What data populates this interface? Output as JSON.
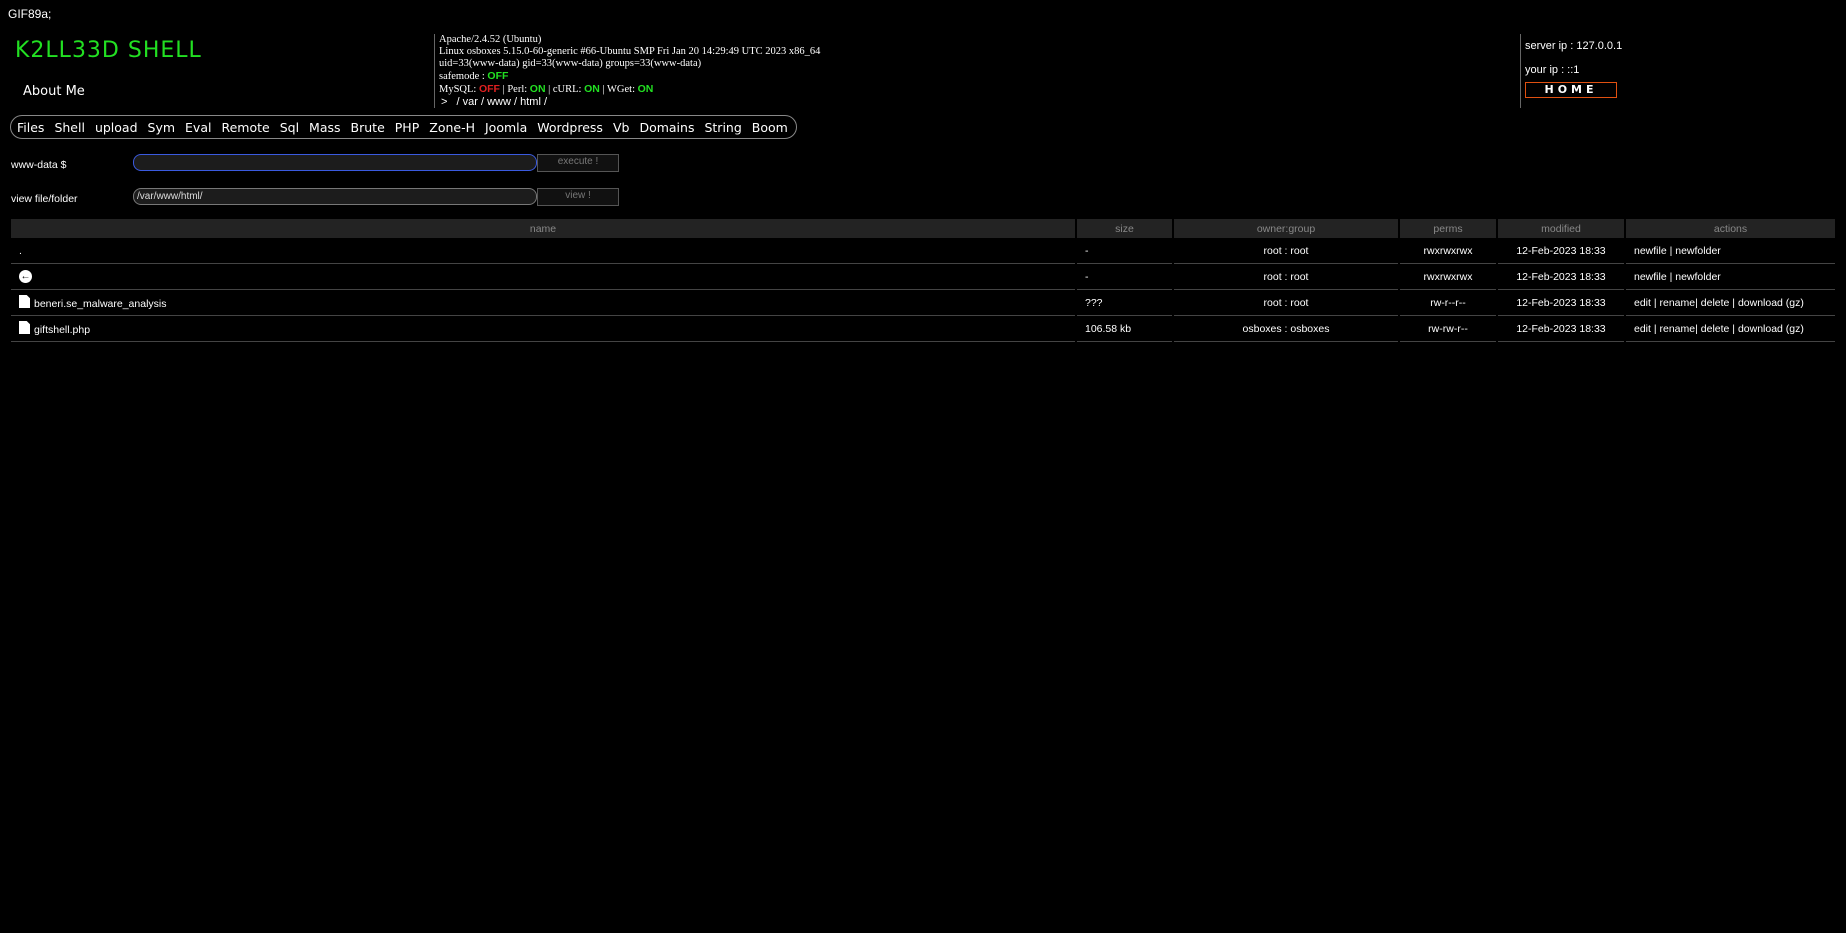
{
  "gif_header": "GIF89a;",
  "logo": "K2LL33D SHELL",
  "about": "About Me",
  "sysinfo": {
    "server_software": "Apache/2.4.52 (Ubuntu)",
    "uname": "Linux osboxes 5.15.0-60-generic #66-Ubuntu SMP Fri Jan 20 14:29:49 UTC 2023 x86_64",
    "user": "uid=33(www-data) gid=33(www-data) groups=33(www-data)",
    "safemode_label": "safemode : ",
    "safemode_value": "OFF",
    "mysql_label": "MySQL: ",
    "mysql_value": "OFF",
    "perl_label": " | Perl: ",
    "perl_value": "ON",
    "curl_label": " | cURL: ",
    "curl_value": "ON",
    "wget_label": " | WGet: ",
    "wget_value": "ON",
    "path_prefix": ">",
    "path_parts": [
      "/",
      "var",
      "/",
      "www",
      "/",
      "html",
      "/"
    ],
    "colors": {
      "on": "#22e022",
      "off": "#e02020"
    }
  },
  "ip": {
    "server_ip": "server ip : 127.0.0.1",
    "your_ip": "your ip : ::1",
    "home_label": "HOME"
  },
  "nav": [
    "Files",
    "Shell",
    "upload",
    "Sym",
    "Eval",
    "Remote",
    "Sql",
    "Mass",
    "Brute",
    "PHP",
    "Zone-H",
    "Joomla",
    "Wordpress",
    "Vb",
    "Domains",
    "String",
    "Boom"
  ],
  "command": {
    "label": "www-data $",
    "value": "",
    "button": "execute !"
  },
  "viewer": {
    "label": "view file/folder",
    "value": "/var/www/html/",
    "button": "view !"
  },
  "table": {
    "headers": [
      "name",
      "size",
      "owner:group",
      "perms",
      "modified",
      "actions"
    ],
    "rows": [
      {
        "icon": "none",
        "name": ".",
        "size": "-",
        "owner": "root : root",
        "perms": "rwxrwxrwx",
        "modified": "12-Feb-2023 18:33",
        "actions": [
          "newfile",
          "newfolder"
        ]
      },
      {
        "icon": "back-arrow-icon",
        "name": "",
        "size": "-",
        "owner": "root : root",
        "perms": "rwxrwxrwx",
        "modified": "12-Feb-2023 18:33",
        "actions": [
          "newfile",
          "newfolder"
        ]
      },
      {
        "icon": "file-icon",
        "name": "beneri.se_malware_analysis",
        "size": "???",
        "owner": "root : root",
        "perms": "rw-r--r--",
        "modified": "12-Feb-2023 18:33",
        "actions": [
          "edit",
          "rename",
          "delete",
          "download (gz)"
        ]
      },
      {
        "icon": "file-icon",
        "name": "giftshell.php",
        "size": "106.58 kb",
        "owner": "osboxes : osboxes",
        "perms": "rw-rw-r--",
        "modified": "12-Feb-2023 18:33",
        "actions": [
          "edit",
          "rename",
          "delete",
          "download (gz)"
        ]
      }
    ]
  }
}
